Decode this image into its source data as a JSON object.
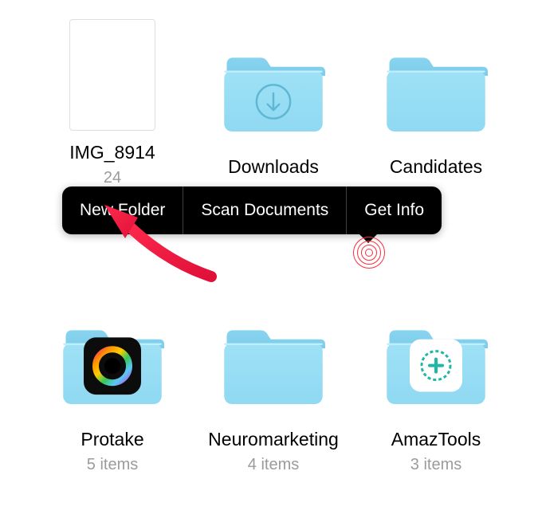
{
  "items": [
    {
      "label": "IMG_8914",
      "sub": "24"
    },
    {
      "label": "Downloads",
      "sub": ""
    },
    {
      "label": "Candidates",
      "sub": ""
    },
    {
      "label": "Protake",
      "sub": "5 items"
    },
    {
      "label": "Neuromarketing",
      "sub": "4 items"
    },
    {
      "label": "AmazTools",
      "sub": "3 items"
    }
  ],
  "context_menu": {
    "new_folder": "New Folder",
    "scan_documents": "Scan Documents",
    "get_info": "Get Info"
  }
}
